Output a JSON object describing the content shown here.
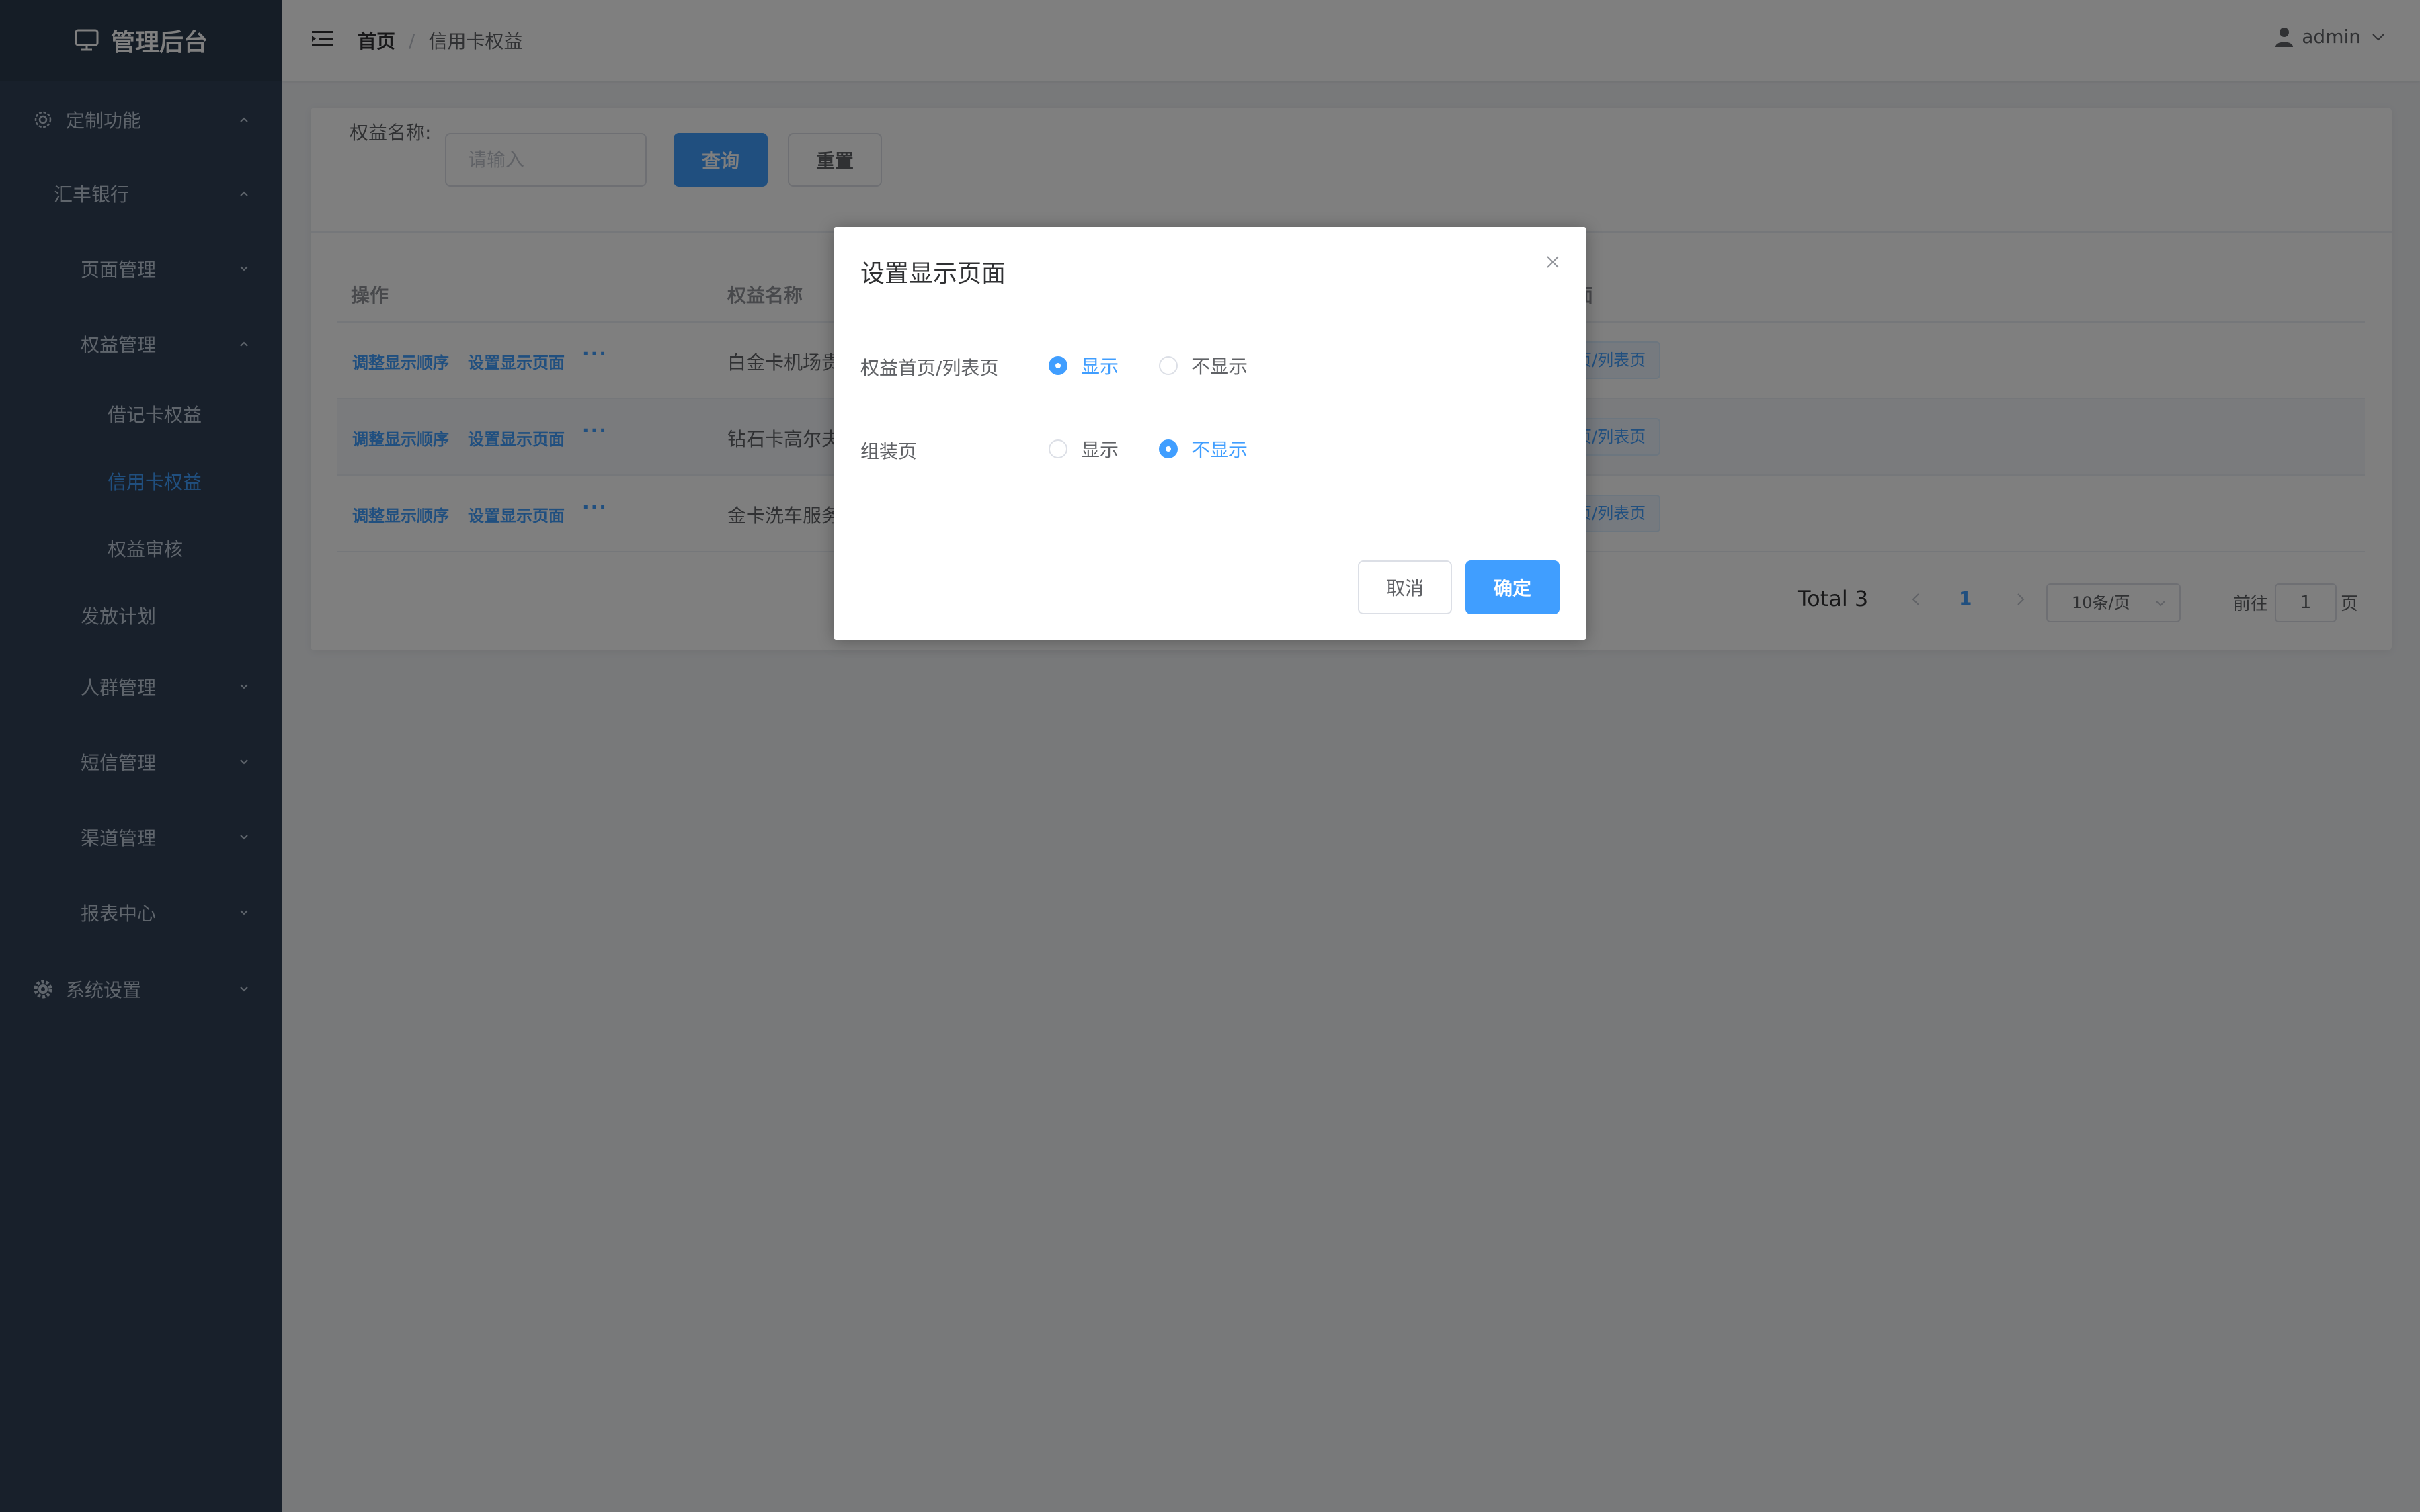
{
  "sidebar": {
    "logo": "管理后台",
    "items": [
      {
        "label": "定制功能"
      },
      {
        "label": "汇丰银行"
      },
      {
        "label": "页面管理"
      },
      {
        "label": "权益管理"
      },
      {
        "label": "借记卡权益"
      },
      {
        "label": "信用卡权益"
      },
      {
        "label": "权益审核"
      },
      {
        "label": "发放计划"
      },
      {
        "label": "人群管理"
      },
      {
        "label": "短信管理"
      },
      {
        "label": "渠道管理"
      },
      {
        "label": "报表中心"
      },
      {
        "label": "系统设置"
      }
    ]
  },
  "header": {
    "breadcrumb_home": "首页",
    "breadcrumb_sep": "/",
    "breadcrumb_current": "信用卡权益",
    "user": "admin"
  },
  "search": {
    "label": "权益名称:",
    "placeholder": "请输入",
    "query_button": "查询",
    "reset_button": "重置"
  },
  "table": {
    "columns": [
      "操作",
      "权益名称",
      "面"
    ],
    "rows": [
      {
        "action1": "调整显示顺序",
        "action2": "设置显示页面",
        "more": "···",
        "name": "白金卡机场贵",
        "tag": "页/列表页"
      },
      {
        "action1": "调整显示顺序",
        "action2": "设置显示页面",
        "more": "···",
        "name": "钻石卡高尔夫",
        "tag": "页/列表页"
      },
      {
        "action1": "调整显示顺序",
        "action2": "设置显示页面",
        "more": "···",
        "name": "金卡洗车服务",
        "tag": "页/列表页"
      }
    ]
  },
  "pagination": {
    "total": "Total 3",
    "current_page": "1",
    "page_size": "10条/页",
    "goto_label": "前往",
    "goto_value": "1",
    "goto_suffix": "页"
  },
  "dialog": {
    "title": "设置显示页面",
    "field1_label": "权益首页/列表页",
    "field1_opt_show": "显示",
    "field1_opt_hide": "不显示",
    "field1_selected": "显示",
    "field2_label": "组装页",
    "field2_opt_show": "显示",
    "field2_opt_hide": "不显示",
    "field2_selected": "不显示",
    "cancel_button": "取消",
    "confirm_button": "确定"
  },
  "colors": {
    "sidebar_bg": "#304156",
    "accent": "#409eff",
    "overlay": "rgba(0,0,0,0.5)"
  }
}
